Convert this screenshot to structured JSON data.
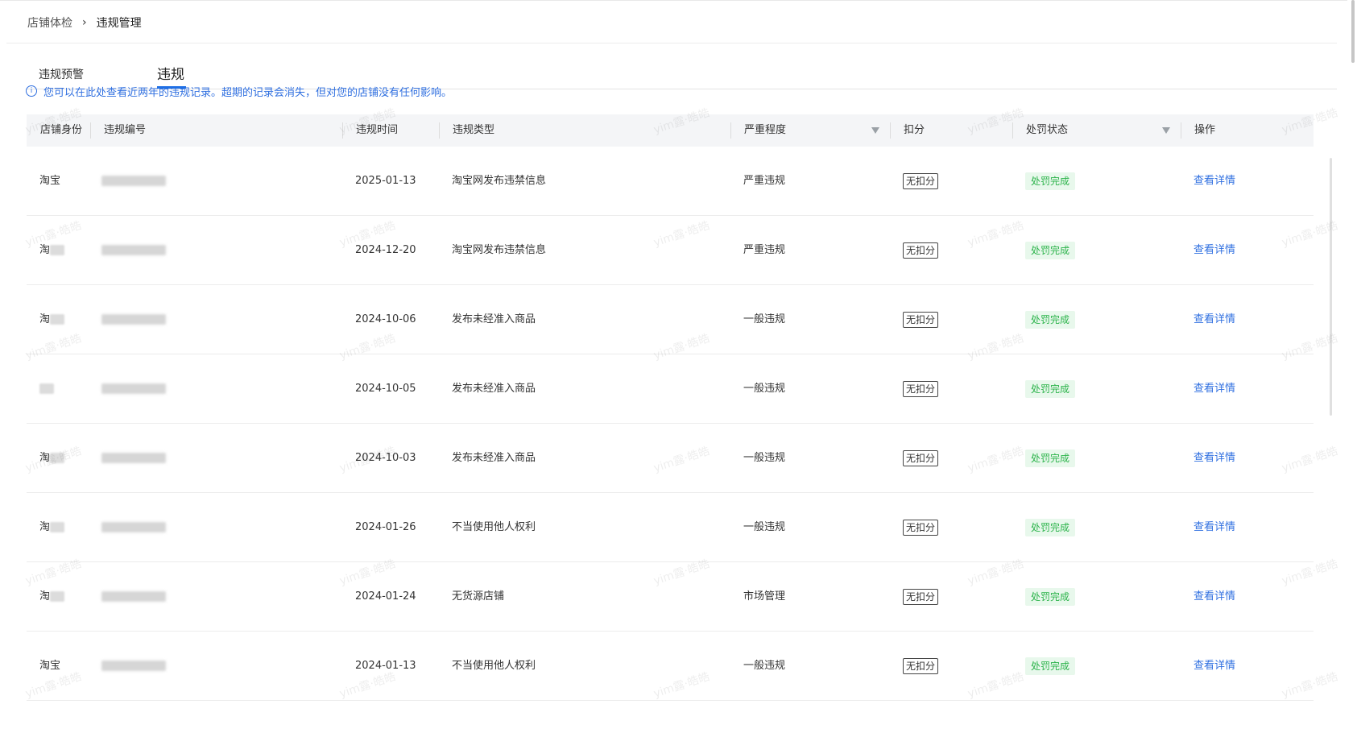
{
  "breadcrumb": {
    "parent": "店铺体检",
    "separator": "›",
    "current": "违规管理"
  },
  "tabs": [
    {
      "label": "违规预警"
    },
    {
      "label": "违规"
    }
  ],
  "notice": {
    "icon": "info-icon",
    "text": "您可以在此处查看近两年的违规记录。超期的记录会消失，但对您的店铺没有任何影响。"
  },
  "table": {
    "headers": {
      "identity": "店铺身份",
      "id": "违规编号",
      "time": "违规时间",
      "type": "违规类型",
      "severity": "严重程度",
      "deduct": "扣分",
      "status": "处罚状态",
      "action": "操作"
    },
    "rows": [
      {
        "identity": "淘宝",
        "date": "2025-01-13",
        "type": "淘宝网发布违禁信息",
        "severity": "严重违规",
        "deduct": "无扣分",
        "status": "处罚完成",
        "action": "查看详情"
      },
      {
        "identity": "淘",
        "date": "2024-12-20",
        "type": "淘宝网发布违禁信息",
        "severity": "严重违规",
        "deduct": "无扣分",
        "status": "处罚完成",
        "action": "查看详情"
      },
      {
        "identity": "淘",
        "date": "2024-10-06",
        "type": "发布未经准入商品",
        "severity": "一般违规",
        "deduct": "无扣分",
        "status": "处罚完成",
        "action": "查看详情"
      },
      {
        "identity": "",
        "date": "2024-10-05",
        "type": "发布未经准入商品",
        "severity": "一般违规",
        "deduct": "无扣分",
        "status": "处罚完成",
        "action": "查看详情"
      },
      {
        "identity": "淘",
        "date": "2024-10-03",
        "type": "发布未经准入商品",
        "severity": "一般违规",
        "deduct": "无扣分",
        "status": "处罚完成",
        "action": "查看详情"
      },
      {
        "identity": "淘",
        "date": "2024-01-26",
        "type": "不当使用他人权利",
        "severity": "一般违规",
        "deduct": "无扣分",
        "status": "处罚完成",
        "action": "查看详情"
      },
      {
        "identity": "淘",
        "date": "2024-01-24",
        "type": "无货源店铺",
        "severity": "市场管理",
        "deduct": "无扣分",
        "status": "处罚完成",
        "action": "查看详情"
      },
      {
        "identity": "淘宝",
        "date": "2024-01-13",
        "type": "不当使用他人权利",
        "severity": "一般违规",
        "deduct": "无扣分",
        "status": "处罚完成",
        "action": "查看详情"
      }
    ]
  },
  "watermark": {
    "text": "yim露·皓皓"
  },
  "colors": {
    "link": "#2f6fe0",
    "status_bg": "#e8f8ec",
    "status_text": "#2bb34a",
    "header_bg": "#f4f5f7"
  }
}
